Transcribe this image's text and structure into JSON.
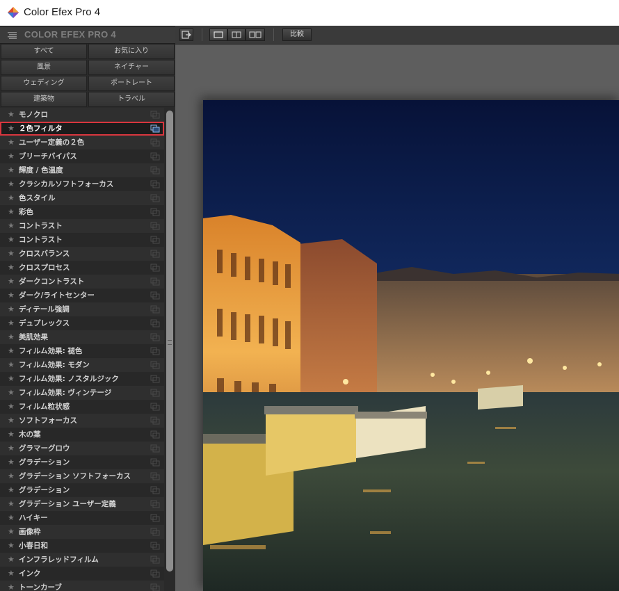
{
  "window": {
    "title": "Color Efex Pro 4"
  },
  "sidebar": {
    "title": "COLOR EFEX PRO 4",
    "categories": [
      "すべて",
      "お気に入り",
      "風景",
      "ネイチャー",
      "ウェディング",
      "ポートレート",
      "建築物",
      "トラベル"
    ],
    "filters": [
      "モノクロ",
      "２色フィルタ",
      "ユーザー定義の２色",
      "ブリーチバイパス",
      "輝度 / 色温度",
      "クラシカルソフトフォーカス",
      "色スタイル",
      "彩色",
      "コントラスト",
      "コントラスト",
      "クロスバランス",
      "クロスプロセス",
      "ダークコントラスト",
      "ダーク/ライトセンター",
      "ディテール強調",
      "デュプレックス",
      "美肌効果",
      "フィルム効果: 褪色",
      "フィルム効果: モダン",
      "フィルム効果: ノスタルジック",
      "フィルム効果: ヴィンテージ",
      "フィルム粒状感",
      "ソフトフォーカス",
      "木の葉",
      "グラマーグロウ",
      "グラデーション",
      "グラデーション ソフトフォーカス",
      "グラデーション",
      "グラデーション ユーザー定義",
      "ハイキー",
      "画像枠",
      "小春日和",
      "インフラレッドフィルム",
      "インク",
      "トーンカーブ"
    ],
    "selected_index": 1
  },
  "toolbar": {
    "compare_label": "比較"
  },
  "colors": {
    "selection_border": "#d9363e",
    "panel": "#2a2a2a",
    "canvas": "#5e5e5e"
  }
}
